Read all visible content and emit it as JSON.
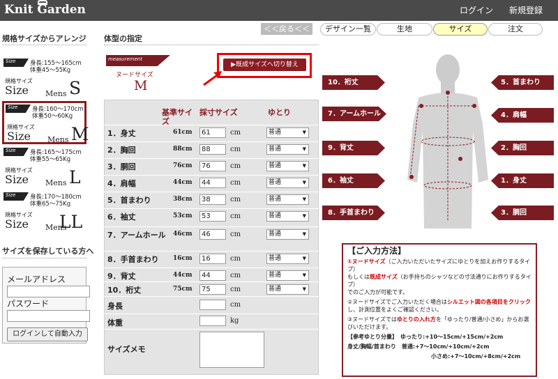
{
  "header": {
    "logo": "Knit Garden",
    "login": "ログイン",
    "register": "新規登録"
  },
  "sidebar": {
    "heading": "規格サイズからアレンジ",
    "cards": [
      {
        "tag": "Size",
        "spec1": "身長:155～165cm",
        "spec2": "体重45～55Kg",
        "small": "規格サイズ",
        "big": "Size",
        "mens": "Mens",
        "letter": "S"
      },
      {
        "tag": "Size",
        "spec1": "身長:160～170cm",
        "spec2": "体重50～60Kg",
        "small": "規格サイズ",
        "big": "Size",
        "mens": "Mens",
        "letter": "M"
      },
      {
        "tag": "Size",
        "spec1": "身長:165～175cm",
        "spec2": "体重55～65Kg",
        "small": "規格サイズ",
        "big": "Size",
        "mens": "Mens",
        "letter": "L"
      },
      {
        "tag": "Size",
        "spec1": "身長:170～180cm",
        "spec2": "体重65～75Kg",
        "small": "規格サイズ",
        "big": "Size",
        "mens": "Mens",
        "letter": "LL"
      }
    ],
    "saved_heading": "サイズを保存している方へ",
    "email_label": "メールアドレス",
    "password_label": "パスワード",
    "login_button": "ログインして自動入力"
  },
  "main": {
    "section_title": "体型の指定",
    "back_button": "＜＜戻る＜＜",
    "tabs": [
      "デザイン一覧",
      "生地",
      "サイズ",
      "注文"
    ],
    "measure_tag": "measurement",
    "nude_label": "ヌードサイズ",
    "nude_size": "M",
    "switch_button": "▶既成サイズへ切り替え",
    "col_base": "基準サイズ",
    "col_take": "採寸サイズ",
    "col_ease": "ゆとり",
    "rows": [
      {
        "label": "1．身丈",
        "base": "61cm",
        "value": "61",
        "unit": "cm",
        "ease": "普通"
      },
      {
        "label": "2．胸回",
        "base": "88cm",
        "value": "88",
        "unit": "cm",
        "ease": "普通"
      },
      {
        "label": "3．胴回",
        "base": "76cm",
        "value": "76",
        "unit": "cm",
        "ease": "普通"
      },
      {
        "label": "4．肩幅",
        "base": "44cm",
        "value": "44",
        "unit": "cm",
        "ease": "普通"
      },
      {
        "label": "5．首まわり",
        "base": "38cm",
        "value": "38",
        "unit": "cm",
        "ease": "普通"
      },
      {
        "label": "6．袖丈",
        "base": "53cm",
        "value": "53",
        "unit": "cm",
        "ease": "普通"
      },
      {
        "label": "7．アームホール",
        "base": "46cm",
        "value": "46",
        "unit": "cm",
        "ease": "普通"
      },
      {
        "label": "8．手首まわり",
        "base": "16cm",
        "value": "16",
        "unit": "cm",
        "ease": "普通"
      },
      {
        "label": "9．背丈",
        "base": "44cm",
        "value": "44",
        "unit": "cm",
        "ease": "普通"
      },
      {
        "label": "10．裄丈",
        "base": "75cm",
        "value": "75",
        "unit": "cm",
        "ease": "普通"
      }
    ],
    "height_label": "身長",
    "height_unit": "cm",
    "weight_label": "体重",
    "weight_unit": "kg",
    "memo_label": "サイズメモ"
  },
  "figure_buttons": {
    "left": [
      "10．裄丈",
      "7．アームホール",
      "9．背丈",
      "6．袖丈",
      "8．手首まわり"
    ],
    "right": [
      "5．首まわり",
      "4．肩幅",
      "2．胸回",
      "1．身丈",
      "3．胴回"
    ]
  },
  "guide": {
    "title": "【ご入力方法】",
    "p1a": "①ヌードサイズ",
    "p1b": "（ご入力いただいたサイズにゆとりを加えお作りするタイプ）",
    "p1c": "もしくは",
    "p1d": "既成サイズ",
    "p1e": "（お手持ちのシャツなどの寸法通りにお作りするタイプ）",
    "p1f": "でのご入力が可能です。",
    "p2a": "②ヌードサイズでご入力いただく場合は",
    "p2b": "シルエット図の各項目をクリック",
    "p2c": "し、計測位置をよくご確認ください。",
    "p3a": "③ヌードサイズでは",
    "p3b": "ゆとりの入れ方",
    "p3c": "を「ゆったり/普通/小さめ」からお選びいただけます。",
    "ref_title": "【参考ゆとり分量】",
    "ref1": "ゆったり:+10～15cm/+15cm/+2cm",
    "ref_items": "身丈/胸幅/首まわり",
    "ref2": "普通:+7～10cm/+10cm/+2cm",
    "ref3": "小さめ:+7～10cm/+8cm/+2cm"
  }
}
